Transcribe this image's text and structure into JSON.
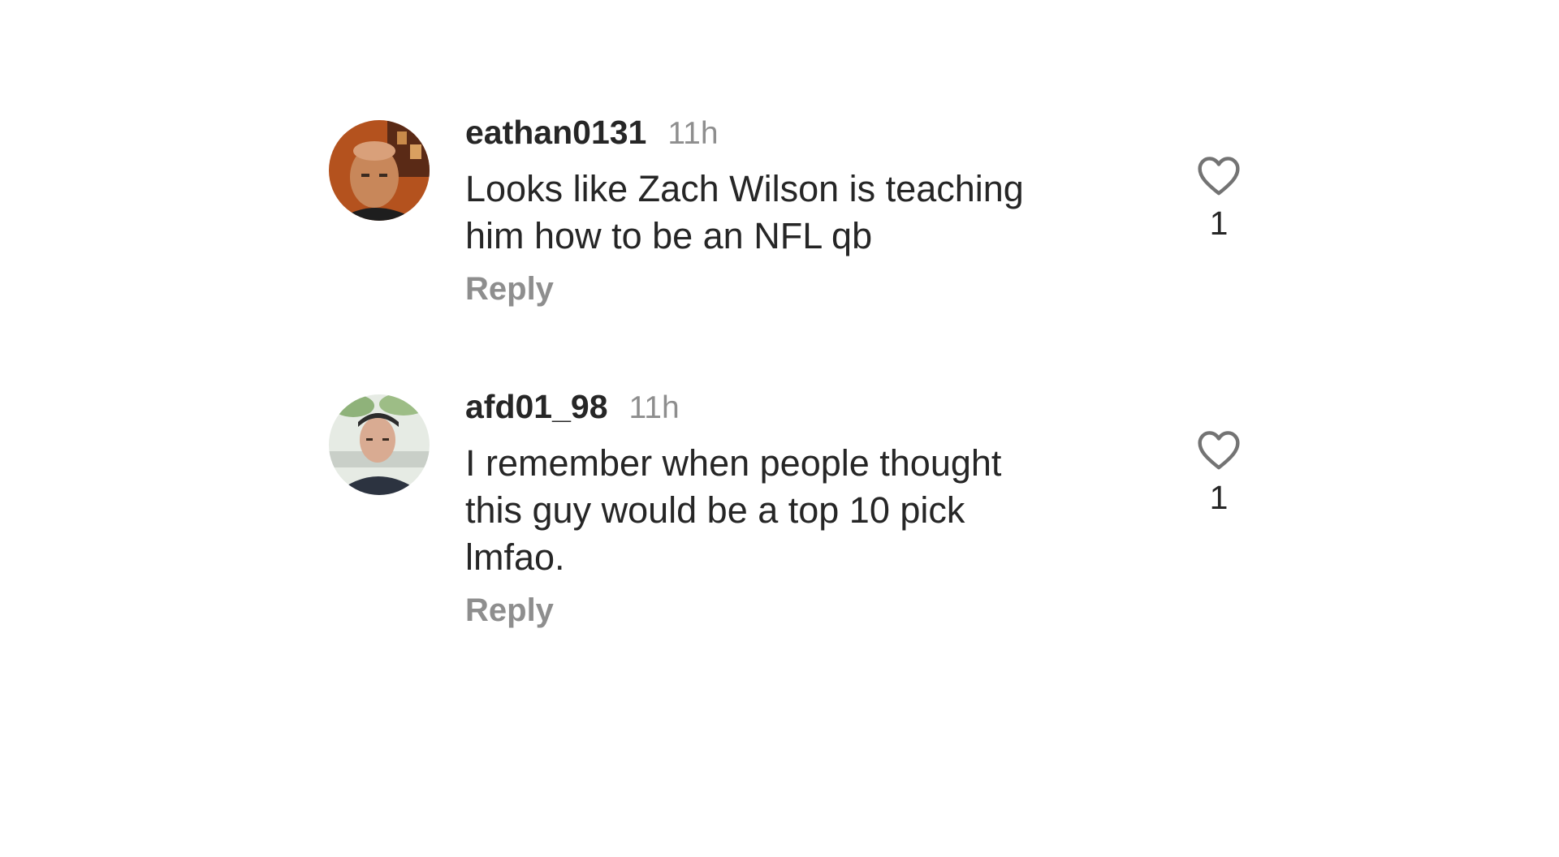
{
  "comments": [
    {
      "username": "eathan0131",
      "time": "11h",
      "text": "Looks like Zach Wilson is teaching\nhim how to be an NFL qb",
      "reply_label": "Reply",
      "like_count": "1"
    },
    {
      "username": "afd01_98",
      "time": "11h",
      "text": "I remember when people thought\nthis guy would be a top 10 pick\nlmfao.",
      "reply_label": "Reply",
      "like_count": "1"
    }
  ],
  "icons": {
    "like": "heart-outline-icon"
  },
  "colors": {
    "text": "#262626",
    "muted": "#8e8e8e",
    "background": "#ffffff"
  }
}
